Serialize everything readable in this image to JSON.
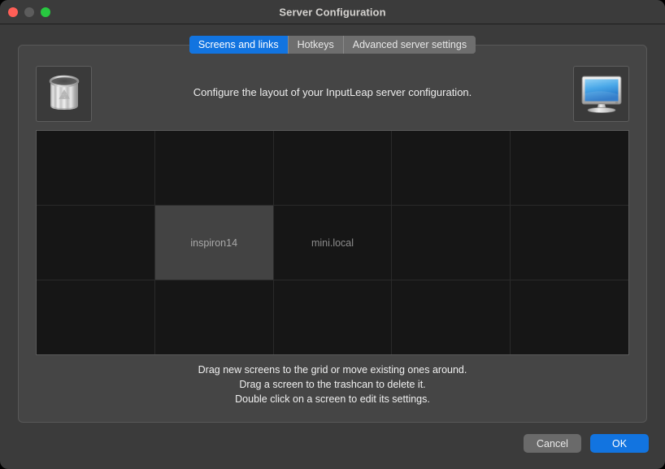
{
  "window": {
    "title": "Server Configuration",
    "controls": [
      {
        "name": "close",
        "color": "#ff5f57"
      },
      {
        "name": "minimize",
        "color": "#5c5c5c"
      },
      {
        "name": "zoom",
        "color": "#28c840"
      }
    ]
  },
  "tabs": [
    {
      "label": "Screens and links",
      "active": true
    },
    {
      "label": "Hotkeys",
      "active": false
    },
    {
      "label": "Advanced server settings",
      "active": false
    }
  ],
  "panel": {
    "caption": "Configure the layout of your InputLeap server configuration.",
    "trash_icon": "trash-can-icon",
    "monitor_icon": "new-screen-monitor-icon"
  },
  "grid": {
    "columns": 5,
    "rows": 3,
    "cells": [
      {
        "label": "",
        "selected": false
      },
      {
        "label": "",
        "selected": false
      },
      {
        "label": "",
        "selected": false
      },
      {
        "label": "",
        "selected": false
      },
      {
        "label": "",
        "selected": false
      },
      {
        "label": "",
        "selected": false
      },
      {
        "label": "inspiron14",
        "selected": true
      },
      {
        "label": "mini.local",
        "selected": false
      },
      {
        "label": "",
        "selected": false
      },
      {
        "label": "",
        "selected": false
      },
      {
        "label": "",
        "selected": false
      },
      {
        "label": "",
        "selected": false
      },
      {
        "label": "",
        "selected": false
      },
      {
        "label": "",
        "selected": false
      },
      {
        "label": "",
        "selected": false
      }
    ]
  },
  "instructions": {
    "line1": "Drag new screens to the grid or move existing ones around.",
    "line2": "Drag a screen to the trashcan to delete it.",
    "line3": "Double click on a screen to edit its settings."
  },
  "footer": {
    "cancel_label": "Cancel",
    "ok_label": "OK"
  },
  "colors": {
    "accent": "#1274e0",
    "window_bg": "#3b3b3b",
    "panel_bg": "#454545",
    "grid_cell": "#161616",
    "grid_cell_selected": "#434343"
  }
}
